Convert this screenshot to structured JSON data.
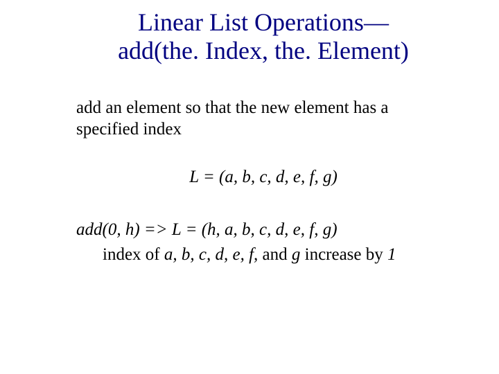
{
  "title_line1": "Linear List Operations—",
  "title_line2": "add(the. Index, the. Element)",
  "description": "add an element so that the new element has a specified index",
  "list_definition": "L = (a, b, c, d, e, f, g)",
  "example_call": "add(0, h) ",
  "example_arrow": " => ",
  "example_result": "L = (h, a, b, c, d, e, f, g)",
  "consequence_prefix": "index of ",
  "consequence_items": "a, b, c, d, e, f, ",
  "consequence_mid": "and ",
  "consequence_last": "g",
  "consequence_suffix": " increase by ",
  "consequence_amount": "1"
}
